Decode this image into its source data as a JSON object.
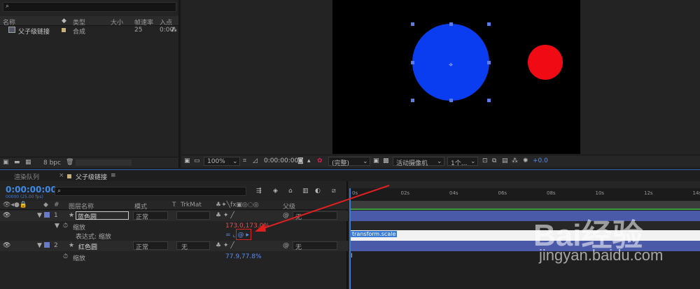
{
  "project": {
    "search_icon": "search-icon",
    "columns": [
      "名称",
      "类型",
      "大小",
      "帧速率",
      "入点"
    ],
    "row": {
      "name": "父子级链接",
      "type": "合成",
      "fps": "25",
      "in": "0:00"
    },
    "bpc": "8 bpc"
  },
  "viewer": {
    "zoom": "100%",
    "time": "0:00:00:00",
    "resolution": "(完整)",
    "camera": "活动摄像机",
    "views": "1个...",
    "exposure": "+0.0",
    "circle_blue": "#0a3cf0",
    "circle_red": "#f00a14"
  },
  "timeline": {
    "tab_render": "渲染队列",
    "tab_comp": "父子级链接",
    "menu": "≡",
    "timecode": "0:00:00:00",
    "timecode_sub": "00000 (25.00 fps)",
    "columns": [
      "#",
      "图层名称",
      "模式",
      "T",
      "TrkMat",
      "父级"
    ],
    "ruler": [
      "0s",
      "02s",
      "04s",
      "06s",
      "08s",
      "10s",
      "12s",
      "14s"
    ],
    "layers": [
      {
        "num": "1",
        "name": "蓝色圆",
        "mode": "正常",
        "trkmat": "",
        "parent": "无",
        "color": "#6a7cc8"
      },
      {
        "num": "2",
        "name": "红色圆",
        "mode": "正常",
        "trkmat": "无",
        "parent": "无",
        "color": "#6a7cc8"
      }
    ],
    "scale_label": "缩放",
    "expr_label": "表达式: 缩放",
    "scale1_value": "173.0,173.0%",
    "scale2_value": "77.9,77.8%",
    "expression": "transform.scale",
    "expr_icons": "= ⌞ @ ▸"
  },
  "watermark": {
    "brand": "Bai经验",
    "url": "jingyan.baidu.com"
  }
}
